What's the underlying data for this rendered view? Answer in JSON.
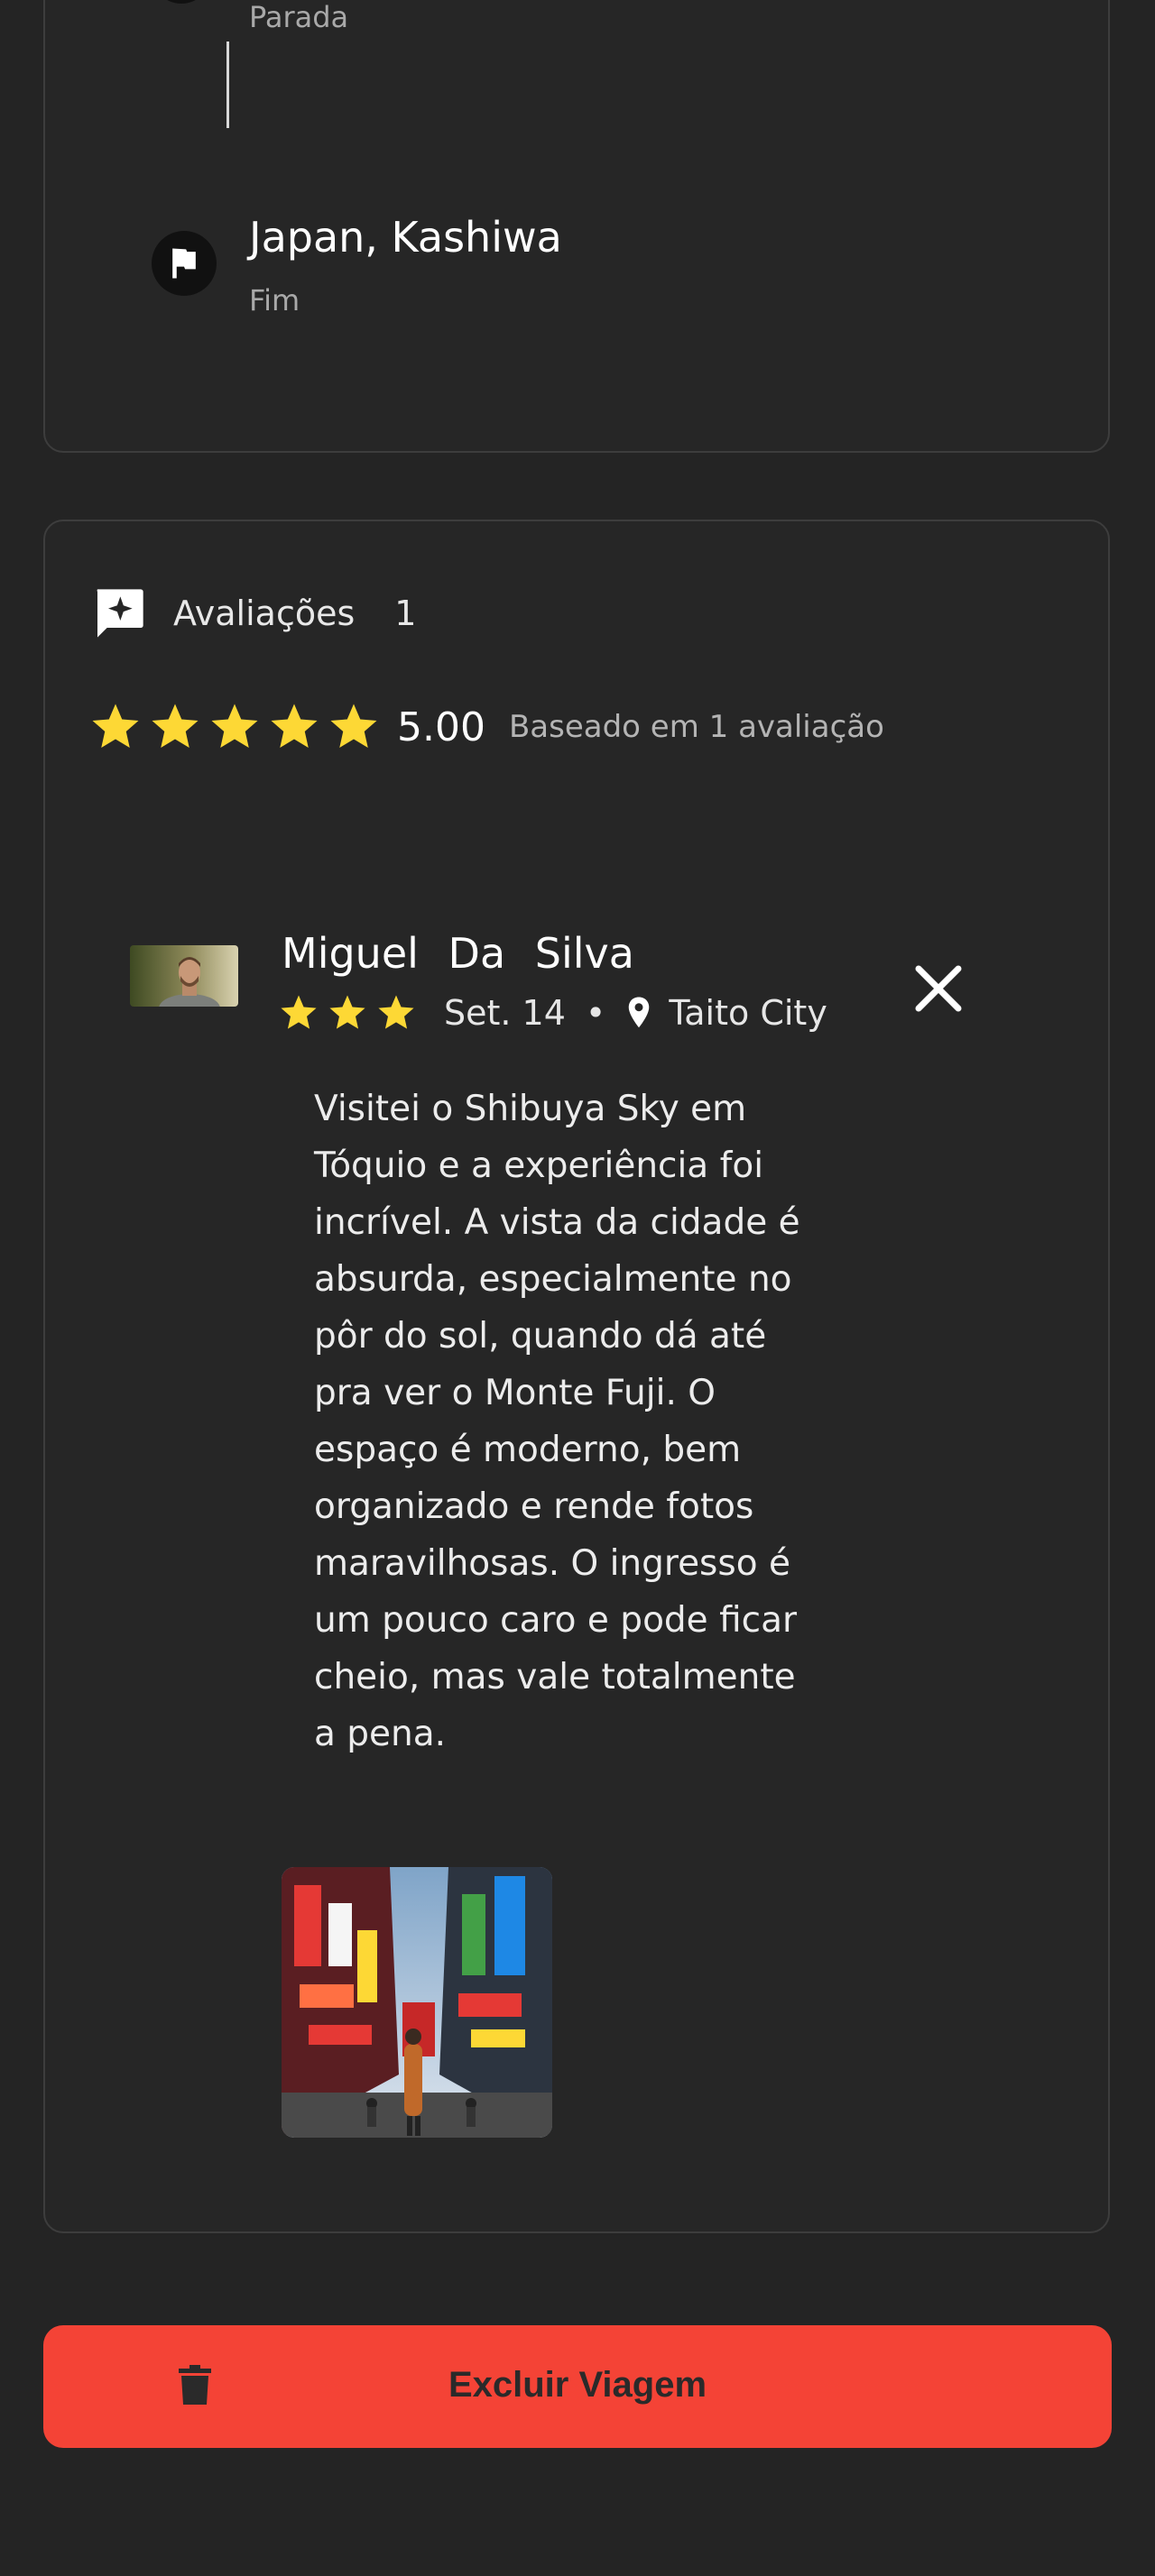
{
  "route": {
    "stop_partial_sub": "Parada",
    "end_place": "Japan, Kashiwa",
    "end_sub": "Fim",
    "end_icon": "flag-icon"
  },
  "reviews": {
    "header_icon": "review-sparkle-icon",
    "header_label": "Avaliações",
    "count": "1",
    "average_stars": 5,
    "average_value": "5.00",
    "basis_text": "Baseado em 1 avaliação",
    "items": [
      {
        "author": "Miguel Da Silva",
        "stars": 3,
        "date": "Set. 14",
        "separator": "•",
        "location_icon": "map-pin-icon",
        "location": "Taito City",
        "text": "Visitei o Shibuya Sky em Tóquio e a experiência foi incrível. A vista da cidade é absurda, especialmente no pôr do sol, quando dá até pra ver o Monte Fuji. O espaço é moderno, bem organizado e rende fotos maravilhosas. O ingresso é um pouco caro e pode ficar cheio, mas vale totalmente a pena."
      }
    ]
  },
  "actions": {
    "delete_label": "Excluir Viagem",
    "delete_icon": "trash-icon"
  },
  "colors": {
    "background": "#242424",
    "star": "#fdd835",
    "danger": "#f44336"
  }
}
